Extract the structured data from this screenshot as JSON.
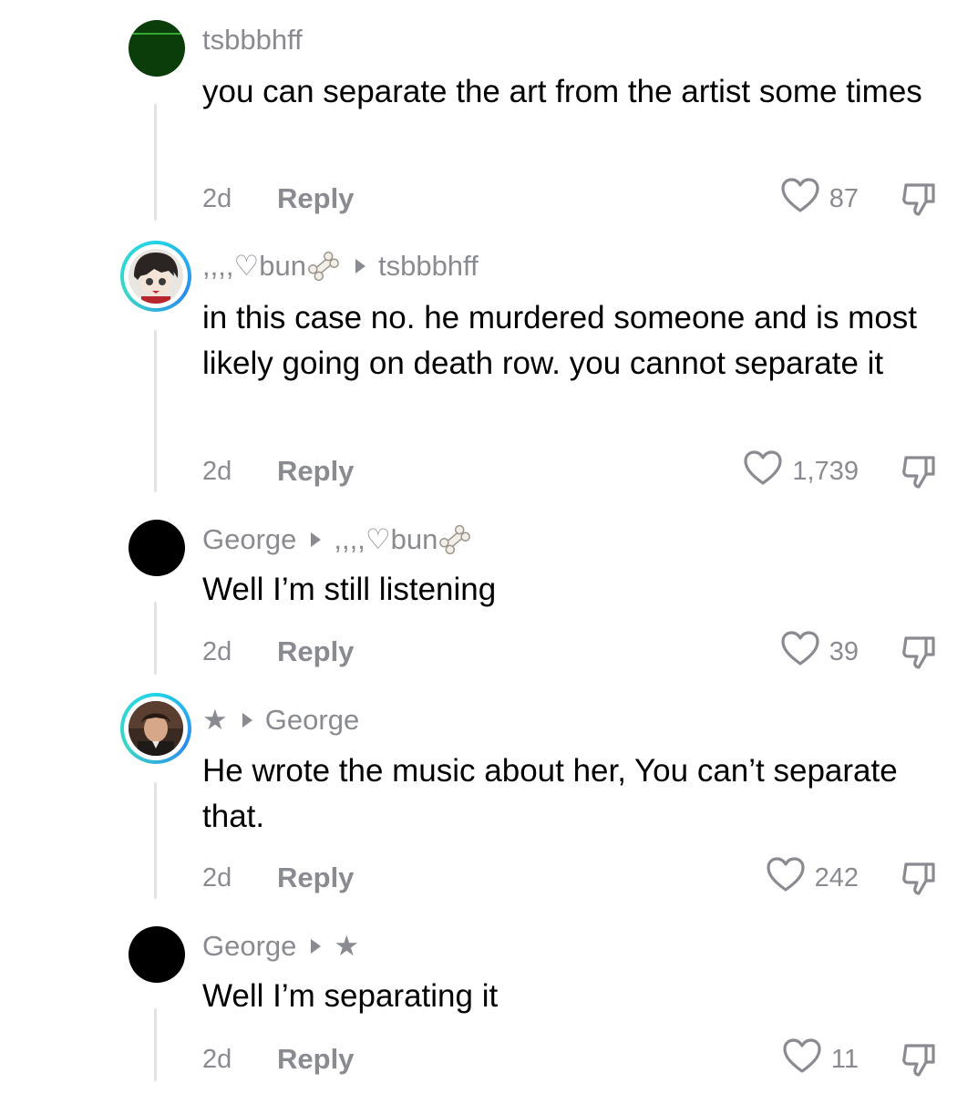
{
  "comments": [
    {
      "username": "tsbbbhff",
      "reply_to": "",
      "text": "you can separate the art from the artist some times",
      "time": "2d",
      "reply_label": "Reply",
      "likes": "87",
      "avatar": "green-dark-avatar"
    },
    {
      "username": ",,,,♡bun",
      "reply_to": "tsbbbhff",
      "text": "in this case no. he murdered someone and is most likely going on death row. you cannot separate it",
      "time": "2d",
      "reply_label": "Reply",
      "likes": "1,739",
      "avatar": "anime-avatar"
    },
    {
      "username": "George",
      "reply_to": ",,,,♡bun",
      "text": "Well I’m still listening",
      "time": "2d",
      "reply_label": "Reply",
      "likes": "39",
      "avatar": "black-avatar"
    },
    {
      "username": "★",
      "reply_to": "George",
      "text": "He wrote the music about her, You can’t separate that.",
      "time": "2d",
      "reply_label": "Reply",
      "likes": "242",
      "avatar": "photo-avatar"
    },
    {
      "username": "George",
      "reply_to": "★",
      "text": "Well I’m separating it",
      "time": "2d",
      "reply_label": "Reply",
      "likes": "11",
      "avatar": "black-avatar"
    }
  ],
  "icons": {
    "like": "heart-outline-icon",
    "dislike": "thumbs-down-icon",
    "reply_arrow": "triangle-right-icon",
    "bun_decoration": "bone-emoji-icon"
  },
  "colors": {
    "text_primary": "#000000",
    "text_secondary": "#8a8b91",
    "thread_line": "#e3e3e4",
    "avatar_ring": "#22d4e8"
  }
}
